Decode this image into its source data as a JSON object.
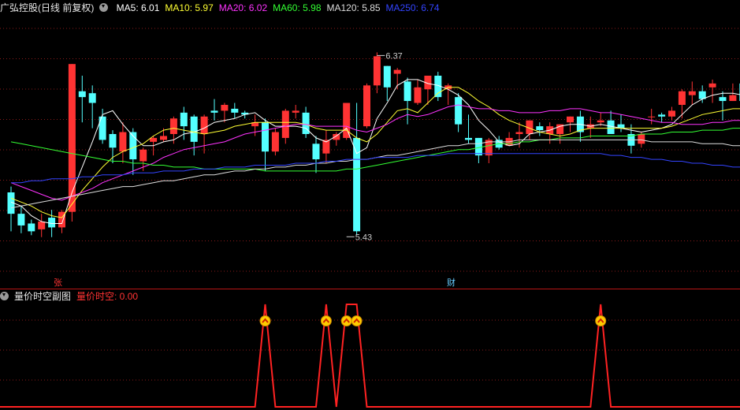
{
  "header": {
    "stock": "广弘控股(日线 前复权)",
    "ma": [
      {
        "label": "MA5: 6.01",
        "color": "#ffffff"
      },
      {
        "label": "MA10: 5.97",
        "color": "#ffff33"
      },
      {
        "label": "MA20: 6.02",
        "color": "#ff33ff"
      },
      {
        "label": "MA60: 5.98",
        "color": "#33ff33"
      },
      {
        "label": "MA120: 5.85",
        "color": "#dddddd"
      },
      {
        "label": "MA250: 6.74",
        "color": "#3344ff"
      }
    ]
  },
  "sub_header": {
    "name": "量价时空副图",
    "value_label": "量价时空: 0.00"
  },
  "markers": {
    "zhang": "张",
    "cai": "财"
  },
  "chart_data": [
    {
      "type": "candlestick",
      "title": "广弘控股(日线 前复权)",
      "ylim": [
        5.2,
        6.55
      ],
      "annotations": [
        {
          "text": "6.37",
          "x": 36,
          "y": 6.37
        },
        {
          "text": "5.43",
          "x": 33,
          "y": 5.43
        }
      ],
      "candles": [
        [
          5.65,
          5.54,
          5.68,
          5.45
        ],
        [
          5.54,
          5.48,
          5.58,
          5.44
        ],
        [
          5.49,
          5.45,
          5.51,
          5.43
        ],
        [
          5.46,
          5.5,
          5.54,
          5.42
        ],
        [
          5.52,
          5.47,
          5.56,
          5.42
        ],
        [
          5.47,
          5.55,
          5.56,
          5.44
        ],
        [
          5.55,
          6.31,
          6.31,
          5.5
        ],
        [
          6.17,
          6.14,
          6.25,
          6.01
        ],
        [
          6.16,
          6.11,
          6.2,
          5.98
        ],
        [
          6.04,
          5.92,
          6.08,
          5.9
        ],
        [
          5.95,
          5.88,
          5.97,
          5.8
        ],
        [
          5.86,
          5.96,
          6.01,
          5.8
        ],
        [
          5.96,
          5.82,
          5.98,
          5.74
        ],
        [
          5.81,
          5.87,
          5.88,
          5.76
        ],
        [
          5.91,
          5.93,
          5.94,
          5.84
        ],
        [
          5.92,
          5.94,
          5.98,
          5.91
        ],
        [
          5.95,
          6.03,
          6.04,
          5.9
        ],
        [
          6.06,
          5.99,
          6.09,
          5.92
        ],
        [
          6.04,
          5.91,
          6.05,
          5.84
        ],
        [
          5.95,
          6.04,
          6.05,
          5.85
        ],
        [
          6.07,
          6.06,
          6.13,
          6.02
        ],
        [
          6.07,
          6.1,
          6.11,
          6.01
        ],
        [
          6.08,
          6.06,
          6.11,
          6.03
        ],
        [
          6.06,
          6.05,
          6.07,
          6.03
        ],
        [
          5.99,
          6.01,
          6.05,
          5.94
        ],
        [
          6.01,
          5.86,
          6.03,
          5.76
        ],
        [
          5.86,
          5.96,
          5.98,
          5.84
        ],
        [
          5.93,
          6.07,
          6.08,
          5.9
        ],
        [
          6.06,
          6.07,
          6.1,
          6.03
        ],
        [
          6.06,
          5.95,
          6.09,
          5.93
        ],
        [
          5.9,
          5.82,
          5.94,
          5.75
        ],
        [
          5.85,
          5.92,
          5.97,
          5.8
        ],
        [
          5.92,
          5.95,
          5.96,
          5.89
        ],
        [
          5.93,
          6.11,
          6.11,
          5.92
        ],
        [
          5.93,
          5.45,
          6.11,
          5.43
        ],
        [
          5.99,
          6.2,
          6.21,
          5.98
        ],
        [
          6.2,
          6.35,
          6.37,
          6.16
        ],
        [
          6.3,
          6.19,
          6.3,
          6.12
        ],
        [
          6.26,
          6.28,
          6.29,
          6.18
        ],
        [
          6.22,
          6.12,
          6.24,
          6.0
        ],
        [
          6.11,
          6.19,
          6.23,
          6.1
        ],
        [
          6.18,
          6.25,
          6.25,
          6.1
        ],
        [
          6.25,
          6.14,
          6.27,
          6.12
        ],
        [
          6.18,
          6.2,
          6.21,
          6.1
        ],
        [
          6.14,
          6.0,
          6.16,
          5.96
        ],
        [
          5.93,
          5.92,
          6.05,
          5.9
        ],
        [
          5.93,
          5.84,
          5.93,
          5.8
        ],
        [
          5.84,
          5.92,
          5.93,
          5.8
        ],
        [
          5.92,
          5.88,
          5.94,
          5.87
        ],
        [
          5.89,
          5.93,
          5.96,
          5.89
        ],
        [
          5.95,
          5.96,
          6.01,
          5.88
        ],
        [
          5.95,
          6.02,
          6.02,
          5.92
        ],
        [
          5.99,
          5.97,
          6.01,
          5.94
        ],
        [
          5.95,
          5.99,
          6.01,
          5.9
        ],
        [
          5.95,
          6.0,
          6.0,
          5.9
        ],
        [
          6.01,
          6.04,
          6.04,
          5.96
        ],
        [
          6.04,
          5.96,
          6.07,
          5.91
        ],
        [
          5.98,
          6.0,
          6.04,
          5.93
        ],
        [
          6.01,
          6.02,
          6.06,
          5.99
        ],
        [
          6.02,
          5.95,
          6.07,
          5.95
        ],
        [
          6.0,
          5.98,
          6.05,
          5.96
        ],
        [
          5.95,
          5.89,
          6.0,
          5.85
        ],
        [
          5.9,
          5.95,
          5.96,
          5.88
        ],
        [
          6.04,
          6.04,
          6.08,
          6.0
        ],
        [
          6.05,
          6.04,
          6.06,
          6.01
        ],
        [
          6.04,
          6.07,
          6.09,
          6.02
        ],
        [
          6.1,
          6.17,
          6.18,
          6.03
        ],
        [
          6.15,
          6.17,
          6.22,
          6.1
        ],
        [
          6.17,
          6.13,
          6.2,
          6.11
        ],
        [
          6.19,
          6.21,
          6.23,
          6.11
        ],
        [
          6.14,
          6.12,
          6.17,
          6.02
        ],
        [
          6.12,
          6.15,
          6.21,
          6.12
        ],
        [
          6.21,
          6.12,
          6.24,
          6.1
        ]
      ],
      "ma_series": [
        {
          "name": "MA5",
          "color": "#ffffff",
          "values": [
            5.6,
            5.58,
            5.53,
            5.5,
            5.49,
            5.49,
            5.65,
            5.78,
            5.91,
            6.05,
            6.07,
            6.0,
            5.94,
            5.89,
            5.89,
            5.91,
            5.92,
            5.95,
            5.96,
            5.98,
            6.01,
            6.02,
            6.03,
            6.05,
            6.06,
            6.02,
            5.99,
            5.99,
            5.99,
            5.98,
            5.93,
            5.91,
            5.94,
            5.98,
            5.85,
            5.88,
            6.03,
            6.11,
            6.2,
            6.23,
            6.23,
            6.21,
            6.2,
            6.18,
            6.15,
            6.1,
            6.02,
            5.97,
            5.91,
            5.89,
            5.9,
            5.95,
            5.96,
            5.97,
            5.99,
            6.0,
            6.0,
            5.99,
            6.0,
            5.99,
            5.98,
            5.97,
            5.96,
            5.97,
            5.98,
            6.0,
            6.05,
            6.1,
            6.13,
            6.15,
            6.16,
            6.16,
            6.15
          ]
        },
        {
          "name": "MA10",
          "color": "#ffff33",
          "values": [
            5.62,
            5.6,
            5.58,
            5.55,
            5.53,
            5.52,
            5.59,
            5.66,
            5.72,
            5.78,
            5.83,
            5.86,
            5.88,
            5.9,
            5.94,
            5.97,
            5.98,
            5.97,
            5.96,
            5.95,
            5.96,
            5.97,
            5.99,
            6.0,
            6.01,
            6.01,
            6.01,
            6.01,
            6.01,
            6.0,
            5.98,
            5.97,
            5.97,
            5.97,
            5.93,
            5.91,
            5.95,
            6.01,
            6.07,
            6.08,
            6.06,
            6.11,
            6.16,
            6.19,
            6.19,
            6.16,
            6.12,
            6.09,
            6.05,
            6.02,
            6.0,
            5.98,
            5.96,
            5.95,
            5.94,
            5.95,
            5.97,
            5.98,
            5.98,
            5.98,
            5.98,
            5.98,
            5.98,
            5.98,
            5.98,
            5.99,
            6.01,
            6.03,
            6.05,
            6.06,
            6.07,
            6.08,
            6.08
          ]
        },
        {
          "name": "MA20",
          "color": "#ff33ff",
          "values": [
            5.7,
            5.68,
            5.66,
            5.64,
            5.62,
            5.61,
            5.63,
            5.65,
            5.67,
            5.7,
            5.72,
            5.74,
            5.76,
            5.78,
            5.8,
            5.83,
            5.85,
            5.87,
            5.88,
            5.89,
            5.9,
            5.91,
            5.93,
            5.95,
            5.96,
            5.97,
            5.98,
            5.99,
            6.0,
            6.0,
            5.99,
            5.99,
            5.99,
            5.99,
            5.97,
            5.96,
            5.98,
            6.0,
            6.03,
            6.05,
            6.04,
            6.05,
            6.07,
            6.09,
            6.1,
            6.09,
            6.08,
            6.08,
            6.07,
            6.07,
            6.06,
            6.06,
            6.06,
            6.07,
            6.07,
            6.08,
            6.08,
            6.07,
            6.06,
            6.06,
            6.05,
            6.04,
            6.03,
            6.02,
            6.01,
            6.01,
            6.0,
            6.0,
            6.0,
            6.01,
            6.01,
            6.02,
            6.02
          ]
        },
        {
          "name": "MA60",
          "color": "#33ff33",
          "values": [
            5.91,
            5.9,
            5.89,
            5.88,
            5.87,
            5.86,
            5.85,
            5.84,
            5.83,
            5.82,
            5.81,
            5.81,
            5.8,
            5.8,
            5.79,
            5.79,
            5.78,
            5.78,
            5.78,
            5.77,
            5.77,
            5.77,
            5.77,
            5.77,
            5.77,
            5.76,
            5.76,
            5.76,
            5.76,
            5.76,
            5.76,
            5.76,
            5.76,
            5.77,
            5.77,
            5.78,
            5.79,
            5.8,
            5.81,
            5.82,
            5.83,
            5.84,
            5.85,
            5.86,
            5.87,
            5.87,
            5.88,
            5.89,
            5.9,
            5.9,
            5.91,
            5.91,
            5.92,
            5.92,
            5.93,
            5.93,
            5.93,
            5.94,
            5.94,
            5.94,
            5.94,
            5.94,
            5.95,
            5.95,
            5.95,
            5.96,
            5.96,
            5.96,
            5.97,
            5.97,
            5.97,
            5.98,
            5.98
          ]
        },
        {
          "name": "MA120",
          "color": "#dddddd",
          "values": [
            5.57,
            5.58,
            5.59,
            5.6,
            5.61,
            5.62,
            5.63,
            5.64,
            5.65,
            5.66,
            5.67,
            5.68,
            5.68,
            5.69,
            5.7,
            5.71,
            5.71,
            5.72,
            5.73,
            5.74,
            5.74,
            5.75,
            5.76,
            5.76,
            5.77,
            5.77,
            5.78,
            5.78,
            5.79,
            5.79,
            5.8,
            5.8,
            5.81,
            5.81,
            5.82,
            5.82,
            5.83,
            5.84,
            5.84,
            5.85,
            5.86,
            5.87,
            5.88,
            5.89,
            5.89,
            5.9,
            5.9,
            5.91,
            5.91,
            5.91,
            5.92,
            5.92,
            5.92,
            5.92,
            5.92,
            5.92,
            5.92,
            5.92,
            5.92,
            5.92,
            5.92,
            5.92,
            5.92,
            5.91,
            5.91,
            5.91,
            5.91,
            5.91,
            5.9,
            5.9,
            5.9,
            5.89,
            5.89
          ]
        },
        {
          "name": "MA250",
          "color": "#3344ff",
          "values": [
            5.7,
            5.7,
            5.71,
            5.71,
            5.72,
            5.72,
            5.72,
            5.73,
            5.73,
            5.74,
            5.74,
            5.74,
            5.75,
            5.75,
            5.75,
            5.76,
            5.76,
            5.76,
            5.77,
            5.77,
            5.77,
            5.78,
            5.78,
            5.78,
            5.79,
            5.79,
            5.79,
            5.79,
            5.8,
            5.8,
            5.8,
            5.81,
            5.81,
            5.82,
            5.82,
            5.82,
            5.83,
            5.83,
            5.83,
            5.83,
            5.84,
            5.84,
            5.84,
            5.85,
            5.85,
            5.85,
            5.85,
            5.85,
            5.85,
            5.85,
            5.85,
            5.85,
            5.85,
            5.85,
            5.85,
            5.85,
            5.85,
            5.85,
            5.85,
            5.84,
            5.84,
            5.83,
            5.83,
            5.82,
            5.82,
            5.81,
            5.81,
            5.8,
            5.8,
            5.79,
            5.79,
            5.78,
            5.78
          ]
        }
      ]
    },
    {
      "type": "line",
      "title": "量价时空副图",
      "ylim": [
        0,
        1
      ],
      "series": [
        {
          "values": [
            0,
            0,
            0,
            0,
            0,
            0,
            0,
            0,
            0,
            0,
            0,
            0,
            0,
            0,
            0,
            0,
            0,
            0,
            0,
            0,
            0,
            0,
            0,
            0,
            0,
            1,
            0,
            0,
            0,
            0,
            0,
            1,
            0,
            1,
            1,
            0,
            0,
            0,
            0,
            0,
            0,
            0,
            0,
            0,
            0,
            0,
            0,
            0,
            0,
            0,
            0,
            0,
            0,
            0,
            0,
            0,
            0,
            0,
            1,
            0,
            0,
            0,
            0,
            0,
            0,
            0,
            0,
            0,
            0,
            0,
            0,
            0,
            0
          ]
        }
      ],
      "signals": [
        25,
        31,
        33,
        34,
        58
      ]
    }
  ]
}
